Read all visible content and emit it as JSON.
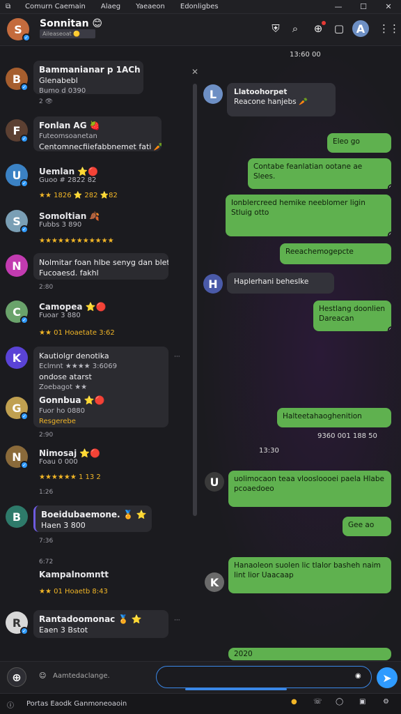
{
  "titlebar": {
    "menu": [
      "Comurn Caemain",
      "Alaeg",
      "Yaeaeon",
      "Edonligbes"
    ],
    "controls": [
      "—",
      "☐",
      "✕"
    ]
  },
  "header": {
    "name": "Sonnitan 😊",
    "subtitle": "Aileaseoat 🟡",
    "icons": [
      "shield-icon",
      "search-icon",
      "notification-icon",
      "card-icon",
      "avatar-icon",
      "grid-icon"
    ]
  },
  "left_list": [
    {
      "name": "Bammanianar p 1ACh 🅰🎃",
      "line": "Glenabebl",
      "meta": "Bumo d 0390",
      "sub": "2 👁"
    },
    {
      "name": "Fonlan AG 🍓",
      "line": "Futeomsoanetan",
      "line2": "Centomnecfiiefabbnemet fati 🥕"
    },
    {
      "name": "Uemlan ⭐🔴",
      "line": "Guoo # 2822 82",
      "meta": "★★ 1826 ⭐ 282 ⭐82"
    },
    {
      "name": "Somoltian 🍂",
      "line": "Fubbs 3 890",
      "meta": "★★★★★★★★★★★★"
    },
    {
      "name": "Nolmitar foan hlbe senyg dan blet",
      "line": "Fucoaesd. fakhl"
    },
    {
      "name": "Camopea ⭐🔴",
      "line": "Fuoar 3 880",
      "meta": "★★ 01 Hoaetate 3:62"
    },
    {
      "name": "Kautiolgr denotika",
      "line": "Eclmnt ★★★★ 3:6069",
      "line2": "ondose atarst",
      "line3": "Zoebagot ★★"
    },
    {
      "name": "Gonnbua ⭐🔴",
      "line": "Fuor ho 0880",
      "meta": "Resgerebe"
    },
    {
      "name": "Nimosaj ⭐🔴",
      "line": "Foau 0 000",
      "meta": "★★★★★★ 1 13 2"
    },
    {
      "name": "Boeidubaemone. 🏅 ⭐",
      "line": "Haen 3 800"
    },
    {
      "name": "Kampalnomntt",
      "line": "★★ 01 Hoaetb 8:43"
    },
    {
      "name": "Rantadoomonac 🏅 ⭐",
      "line": "Eaen 3 Bstot"
    }
  ],
  "left_times": [
    "2:80",
    "2:90",
    "1:26",
    "7:36",
    "6:72"
  ],
  "right": {
    "date": "13:60 00",
    "incoming1": {
      "name": "Llatoohorpet",
      "line": "Reacone hanjebs 🥕"
    },
    "out1": "Eleo go",
    "out2": "Contabe feanlatian ootane ae Slees.",
    "out3": "Ionblercreed hemike neeblomer ligin Stluig otto",
    "out4": "Reeachemogepcte",
    "incoming2": "Haplerhani beheslke",
    "out5": "Hestlang doonlien Dareacan",
    "out6": "Halteetahaoghenition",
    "reacts": "9360 001   188 50",
    "reacts2": "13:30",
    "incoming3": "uolimocaon teaa vloosloooei paela Hlabe pcoaedoeo",
    "out7": "Gee ao",
    "out8": "Hanaoleon suolen lic tlalor basheh naim lint lior Uaacaap",
    "out9": "2020"
  },
  "composer": {
    "placeholder": "Aamtedaclange.",
    "send": "send"
  },
  "statusbar": {
    "text": "Portas Eaodk Ganmoneoaoin"
  }
}
